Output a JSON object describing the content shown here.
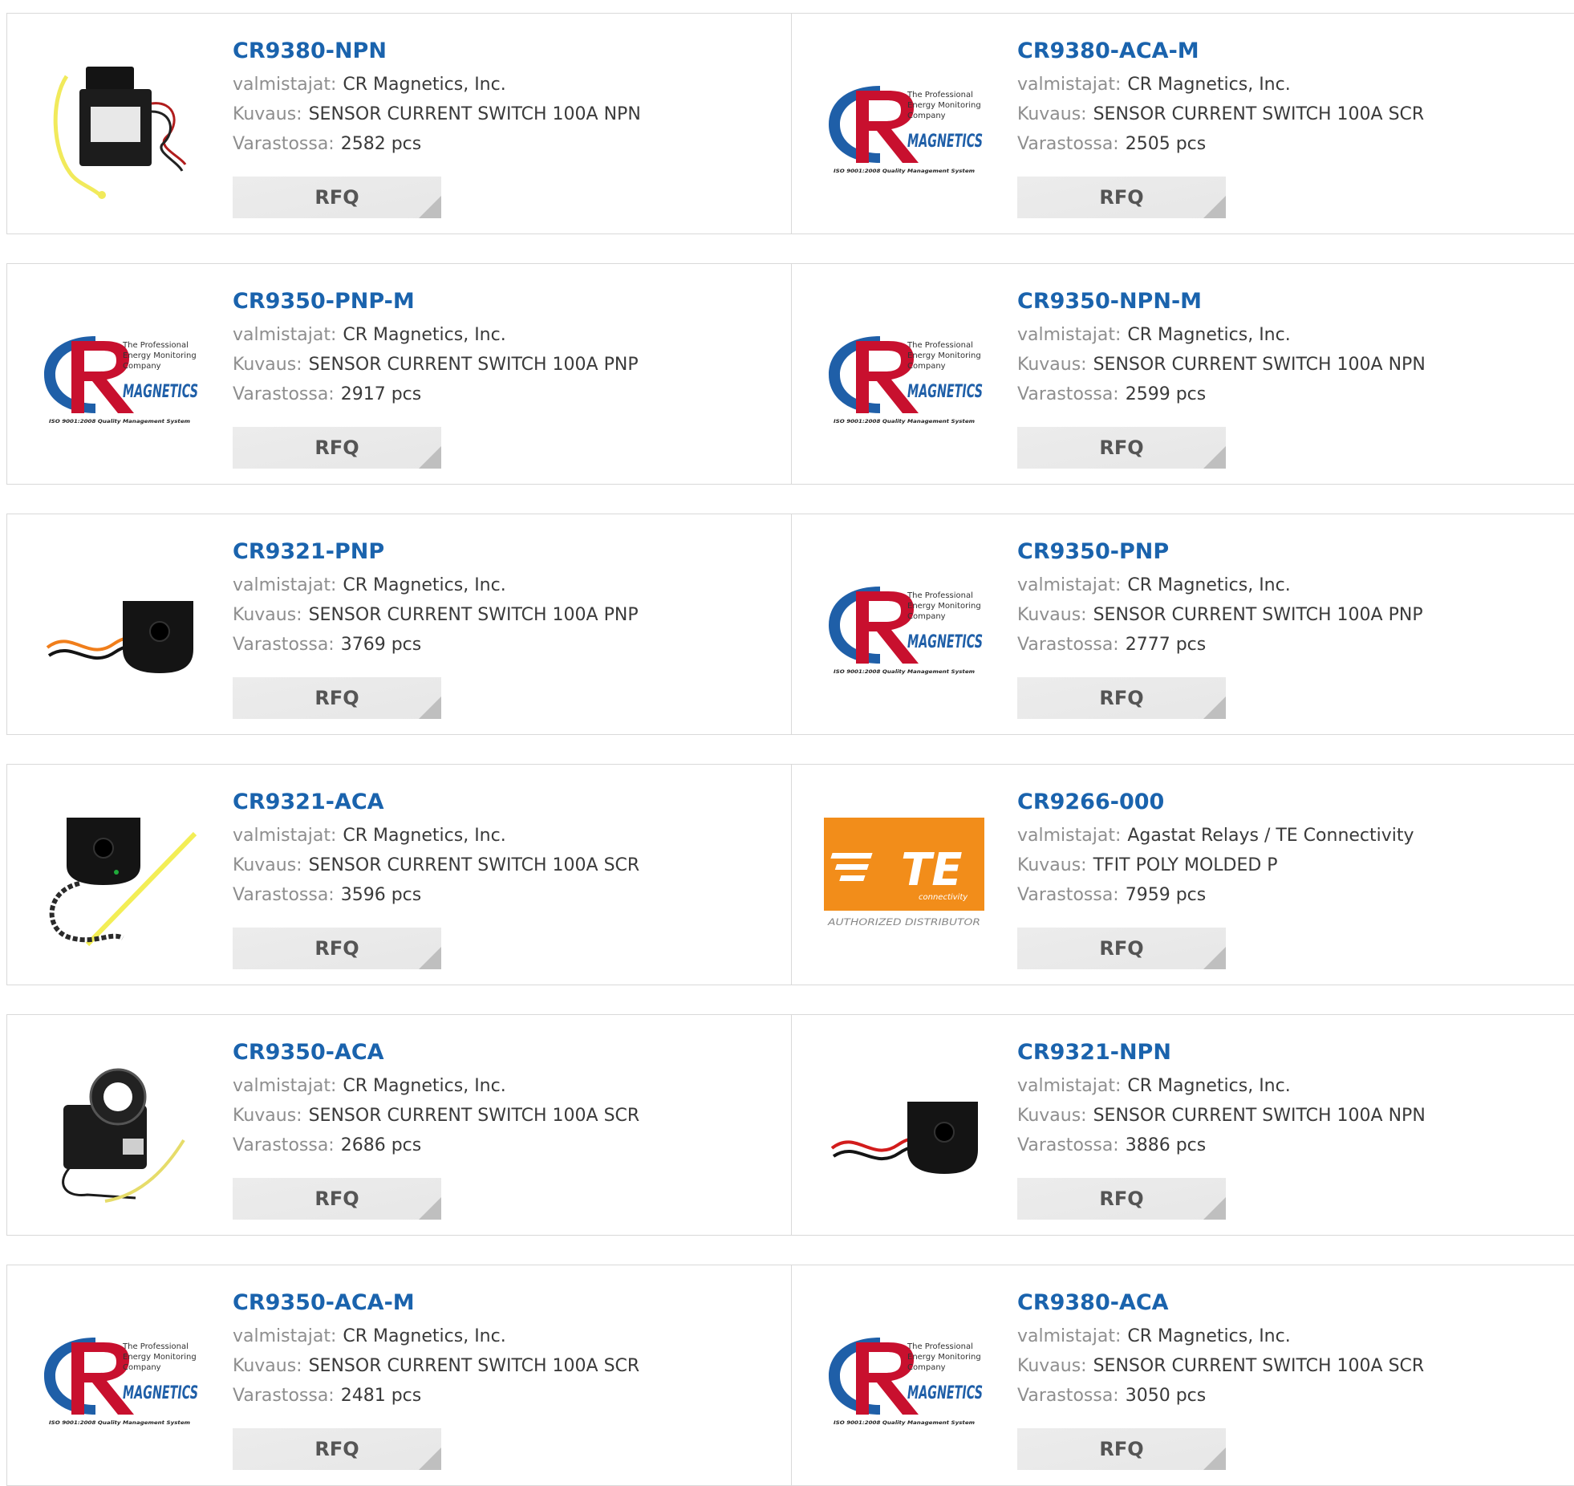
{
  "labels": {
    "manufacturer": "valmistajat:",
    "description": "Kuvaus:",
    "stock": "Varastossa:",
    "rfq": "RFQ"
  },
  "logo_text": {
    "cr_line1": "The Professional",
    "cr_line2": "Energy Monitoring",
    "cr_line3": "Company",
    "cr_brand": "MAGNETICS",
    "cr_iso": "ISO 9001:2008 Quality Management System",
    "te_mark": "TE",
    "te_sub": "connectivity",
    "te_auth": "AUTHORIZED DISTRIBUTOR"
  },
  "colors": {
    "link": "#1a63ad",
    "label": "#8e8e8e",
    "value": "#3a3a3a",
    "button_bg": "#ececec",
    "te_orange": "#f28d1a",
    "cr_red": "#c8102e",
    "cr_blue": "#1f5fa8"
  },
  "products": [
    {
      "part": "CR9380-NPN",
      "manufacturer": "CR Magnetics, Inc.",
      "description": "SENSOR CURRENT SWITCH 100A NPN",
      "stock": "2582 pcs",
      "image": "sensor-tie-photo"
    },
    {
      "part": "CR9380-ACA-M",
      "manufacturer": "CR Magnetics, Inc.",
      "description": "SENSOR CURRENT SWITCH 100A SCR",
      "stock": "2505 pcs",
      "image": "cr-magnetics-logo"
    },
    {
      "part": "CR9350-PNP-M",
      "manufacturer": "CR Magnetics, Inc.",
      "description": "SENSOR CURRENT SWITCH 100A PNP",
      "stock": "2917 pcs",
      "image": "cr-magnetics-logo"
    },
    {
      "part": "CR9350-NPN-M",
      "manufacturer": "CR Magnetics, Inc.",
      "description": "SENSOR CURRENT SWITCH 100A NPN",
      "stock": "2599 pcs",
      "image": "cr-magnetics-logo"
    },
    {
      "part": "CR9321-PNP",
      "manufacturer": "CR Magnetics, Inc.",
      "description": "SENSOR CURRENT SWITCH 100A PNP",
      "stock": "3769 pcs",
      "image": "donut-orange-photo"
    },
    {
      "part": "CR9350-PNP",
      "manufacturer": "CR Magnetics, Inc.",
      "description": "SENSOR CURRENT SWITCH 100A PNP",
      "stock": "2777 pcs",
      "image": "cr-magnetics-logo"
    },
    {
      "part": "CR9321-ACA",
      "manufacturer": "CR Magnetics, Inc.",
      "description": "SENSOR CURRENT SWITCH 100A SCR",
      "stock": "3596 pcs",
      "image": "donut-tie-photo"
    },
    {
      "part": "CR9266-000",
      "manufacturer": "Agastat Relays / TE Connectivity",
      "description": "TFIT POLY MOLDED P",
      "stock": "7959 pcs",
      "image": "te-logo"
    },
    {
      "part": "CR9350-ACA",
      "manufacturer": "CR Magnetics, Inc.",
      "description": "SENSOR CURRENT SWITCH 100A SCR",
      "stock": "2686 pcs",
      "image": "ring-sensor-photo"
    },
    {
      "part": "CR9321-NPN",
      "manufacturer": "CR Magnetics, Inc.",
      "description": "SENSOR CURRENT SWITCH 100A NPN",
      "stock": "3886 pcs",
      "image": "donut-red-photo"
    },
    {
      "part": "CR9350-ACA-M",
      "manufacturer": "CR Magnetics, Inc.",
      "description": "SENSOR CURRENT SWITCH 100A SCR",
      "stock": "2481 pcs",
      "image": "cr-magnetics-logo"
    },
    {
      "part": "CR9380-ACA",
      "manufacturer": "CR Magnetics, Inc.",
      "description": "SENSOR CURRENT SWITCH 100A SCR",
      "stock": "3050 pcs",
      "image": "cr-magnetics-logo"
    }
  ]
}
